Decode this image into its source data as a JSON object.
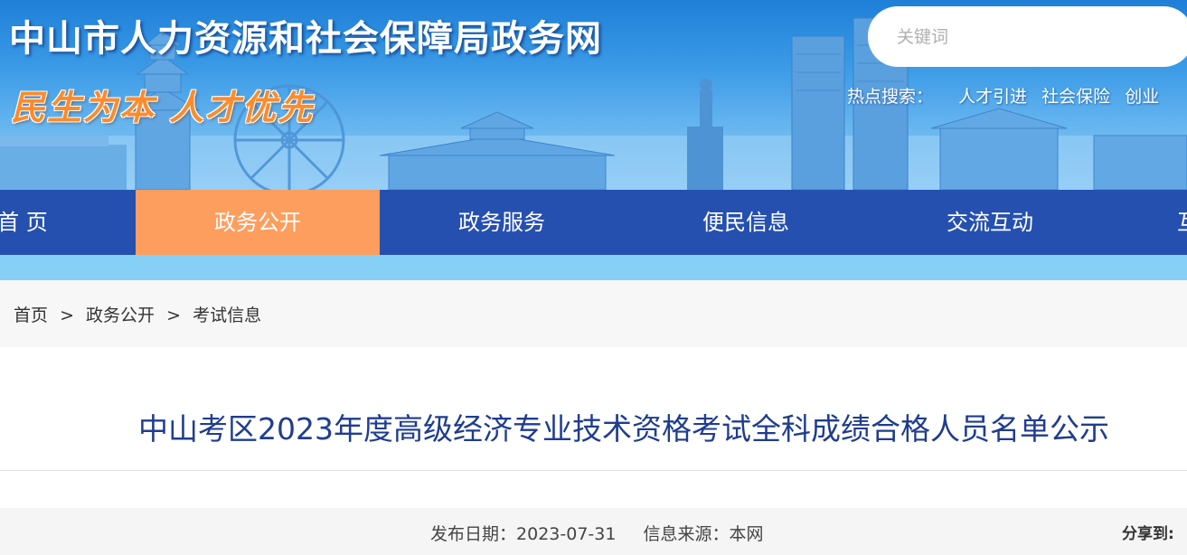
{
  "header": {
    "site_title": "中山市人力资源和社会保障局政务网",
    "slogan": "民生为本 人才优先",
    "search": {
      "placeholder": "关键词"
    },
    "hot_search": {
      "label": "热点搜索：",
      "links": [
        "人才引进",
        "社会保险",
        "创业"
      ]
    }
  },
  "nav": {
    "items": [
      "首 页",
      "政务公开",
      "政务服务",
      "便民信息",
      "交流互动"
    ],
    "active": "政务公开",
    "overflow_glyph": "互"
  },
  "breadcrumb": {
    "items": [
      "首页",
      "政务公开",
      "考试信息"
    ],
    "separator": ">"
  },
  "article": {
    "title": "中山考区2023年度高级经济专业技术资格考试全科成绩合格人员名单公示",
    "publish_label": "发布日期：",
    "publish_date": "2023-07-31",
    "source_label": "信息来源：",
    "source": "本网",
    "share_label": "分享到:"
  },
  "colors": {
    "nav_bg": "#2550b0",
    "nav_active": "#fe9e5e",
    "title_text": "#1f3d8f",
    "slogan": "#ff8a2a"
  }
}
